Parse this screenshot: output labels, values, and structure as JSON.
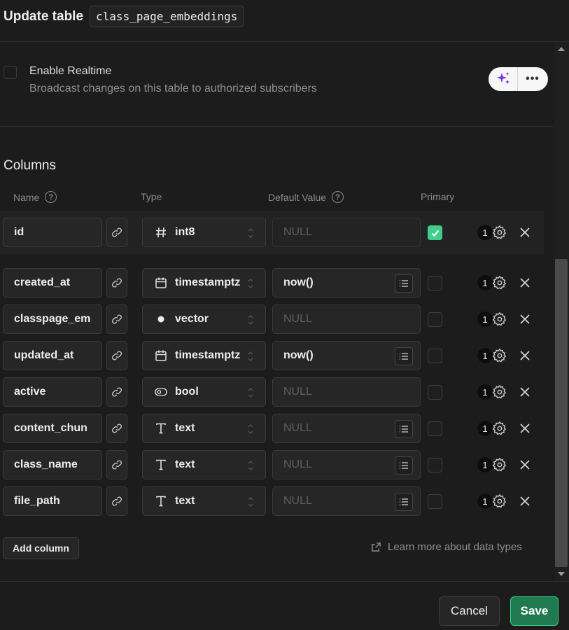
{
  "header": {
    "title": "Update table",
    "table_name": "class_page_embeddings"
  },
  "realtime": {
    "title": "Enable Realtime",
    "description": "Broadcast changes on this table to authorized subscribers",
    "checked": false,
    "more_label": "•••"
  },
  "columns_section": {
    "title": "Columns",
    "headers": {
      "name": "Name",
      "type": "Type",
      "default_value": "Default Value",
      "primary": "Primary"
    },
    "help_glyph": "?"
  },
  "rows": [
    {
      "name": "id",
      "type": "int8",
      "type_icon": "hash-icon",
      "default": "NULL",
      "default_is_placeholder": true,
      "has_list_button": false,
      "primary": true,
      "count": "1"
    },
    {
      "name": "created_at",
      "type": "timestamptz",
      "type_icon": "calendar-icon",
      "default": "now()",
      "default_is_placeholder": false,
      "has_list_button": true,
      "primary": false,
      "count": "1"
    },
    {
      "name": "classpage_em",
      "type": "vector",
      "type_icon": "dot-icon",
      "default": "NULL",
      "default_is_placeholder": true,
      "has_list_button": false,
      "primary": false,
      "count": "1"
    },
    {
      "name": "updated_at",
      "type": "timestamptz",
      "type_icon": "calendar-icon",
      "default": "now()",
      "default_is_placeholder": false,
      "has_list_button": true,
      "primary": false,
      "count": "1"
    },
    {
      "name": "active",
      "type": "bool",
      "type_icon": "toggle-icon",
      "default": "NULL",
      "default_is_placeholder": true,
      "has_list_button": false,
      "primary": false,
      "count": "1"
    },
    {
      "name": "content_chun",
      "type": "text",
      "type_icon": "text-icon",
      "default": "NULL",
      "default_is_placeholder": true,
      "has_list_button": true,
      "primary": false,
      "count": "1"
    },
    {
      "name": "class_name",
      "type": "text",
      "type_icon": "text-icon",
      "default": "NULL",
      "default_is_placeholder": true,
      "has_list_button": true,
      "primary": false,
      "count": "1"
    },
    {
      "name": "file_path",
      "type": "text",
      "type_icon": "text-icon",
      "default": "NULL",
      "default_is_placeholder": true,
      "has_list_button": true,
      "primary": false,
      "count": "1"
    }
  ],
  "actions": {
    "add_column": "Add column",
    "learn_more": "Learn more about data types"
  },
  "footer": {
    "cancel": "Cancel",
    "save": "Save"
  },
  "colors": {
    "accent": "#3ecf8e",
    "save_bg": "#207a4f",
    "sparkle": "#7c3aed"
  }
}
